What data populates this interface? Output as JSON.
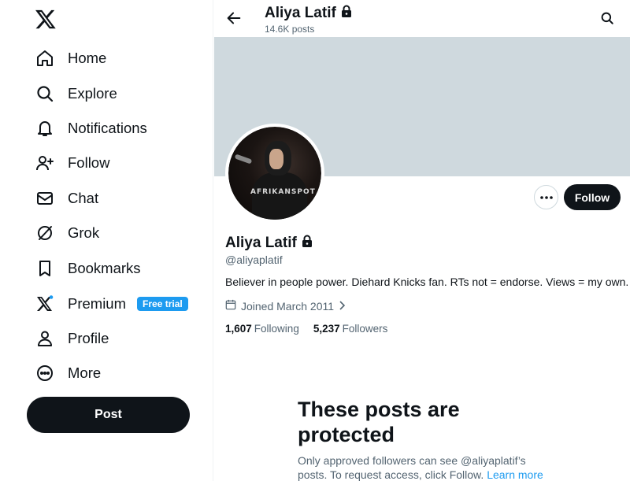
{
  "sidebar": {
    "logo_icon": "x-logo-icon",
    "items": [
      {
        "label": "Home",
        "icon": "home-icon"
      },
      {
        "label": "Explore",
        "icon": "search-icon"
      },
      {
        "label": "Notifications",
        "icon": "bell-icon"
      },
      {
        "label": "Follow",
        "icon": "person-add-icon"
      },
      {
        "label": "Chat",
        "icon": "envelope-icon"
      },
      {
        "label": "Grok",
        "icon": "grok-icon"
      },
      {
        "label": "Bookmarks",
        "icon": "bookmark-icon"
      },
      {
        "label": "Premium",
        "icon": "x-premium-icon",
        "badge": "Free trial"
      },
      {
        "label": "Profile",
        "icon": "person-icon"
      },
      {
        "label": "More",
        "icon": "more-circle-icon"
      }
    ],
    "post_label": "Post"
  },
  "header": {
    "name": "Aliya Latif",
    "posts_count": "14.6K posts"
  },
  "profile": {
    "avatar_watermark": "AFRIKANSPOT",
    "follow_label": "Follow",
    "name": "Aliya Latif",
    "handle": "@aliyaplatif",
    "bio": "Believer in people power. Diehard Knicks fan. RTs not = endorse. Views = my own.",
    "joined": "Joined March 2011",
    "following_count": "1,607",
    "following_label": "Following",
    "followers_count": "5,237",
    "followers_label": "Followers"
  },
  "protected": {
    "title": "These posts are protected",
    "desc_text": "Only approved followers can see @aliyaplatif’s posts. To request access, click Follow.",
    "learn_more": "Learn more"
  },
  "colors": {
    "accent": "#1d9bf0",
    "text": "#0f1419",
    "secondary": "#536471",
    "banner": "#cfd9de"
  }
}
